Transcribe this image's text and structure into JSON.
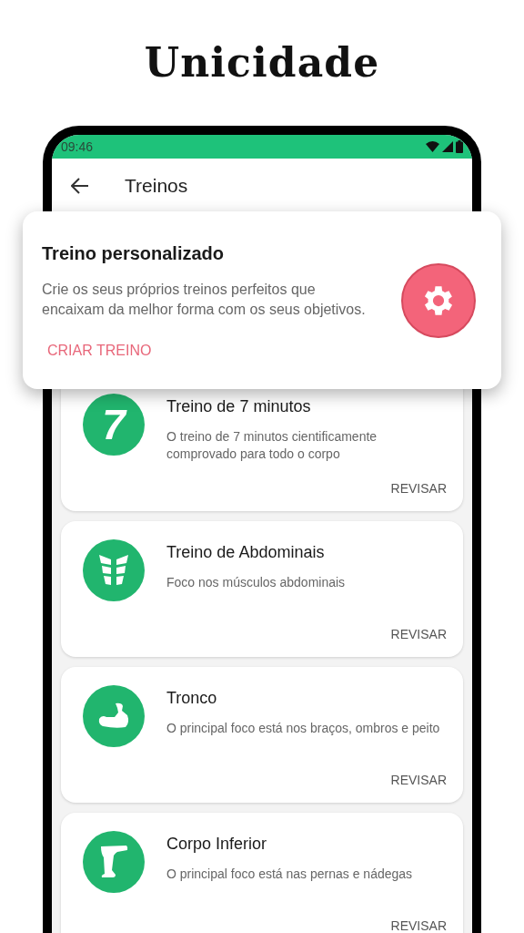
{
  "headline": "Unicidade",
  "status_bar": {
    "time": "09:46"
  },
  "app_bar": {
    "title": "Treinos"
  },
  "popup": {
    "title": "Treino personalizado",
    "description": "Crie os seus próprios treinos perfeitos que encaixam da melhor forma com os seus objetivos.",
    "action": "CRIAR TREINO"
  },
  "workouts": [
    {
      "kind": "number",
      "badge": "7",
      "title": "Treino de 7 minutos",
      "description": "O treino de 7 minutos cientificamente comprovado para todo o corpo",
      "action": "REVISAR"
    },
    {
      "kind": "abs",
      "title": "Treino de Abdominais",
      "description": "Foco nos músculos abdominais",
      "action": "REVISAR"
    },
    {
      "kind": "arm",
      "title": "Tronco",
      "description": "O principal foco está nos braços, ombros e peito",
      "action": "REVISAR"
    },
    {
      "kind": "leg",
      "title": "Corpo Inferior",
      "description": "O principal foco está nas pernas e nádegas",
      "action": "REVISAR"
    }
  ]
}
